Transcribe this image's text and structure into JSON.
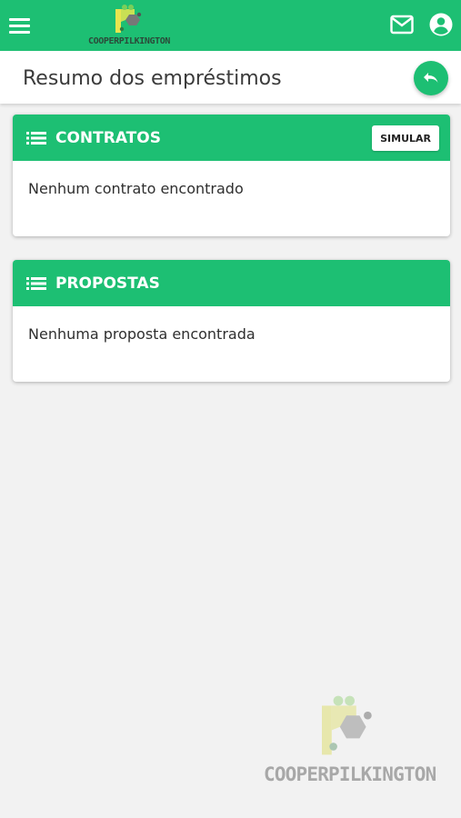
{
  "app": {
    "brand_name": "COOPERPILKINGTON",
    "brand_colors": {
      "accent": "#1dbf73",
      "logo_yellow": "#e8e54f",
      "logo_gray": "#777777"
    }
  },
  "topbar": {
    "menu_icon": "hamburger-menu-icon",
    "mail_icon": "mail-icon",
    "account_icon": "account-circle-icon"
  },
  "page": {
    "title": "Resumo dos empréstimos",
    "back_icon": "undo-arrow-icon"
  },
  "sections": {
    "contratos": {
      "title": "CONTRATOS",
      "icon": "list-icon",
      "action_label": "SIMULAR",
      "empty_message": "Nenhum contrato encontrado"
    },
    "propostas": {
      "title": "PROPOSTAS",
      "icon": "list-icon",
      "empty_message": "Nenhuma proposta encontrada"
    }
  },
  "watermark": {
    "text": "COOPERPILKINGTON"
  }
}
